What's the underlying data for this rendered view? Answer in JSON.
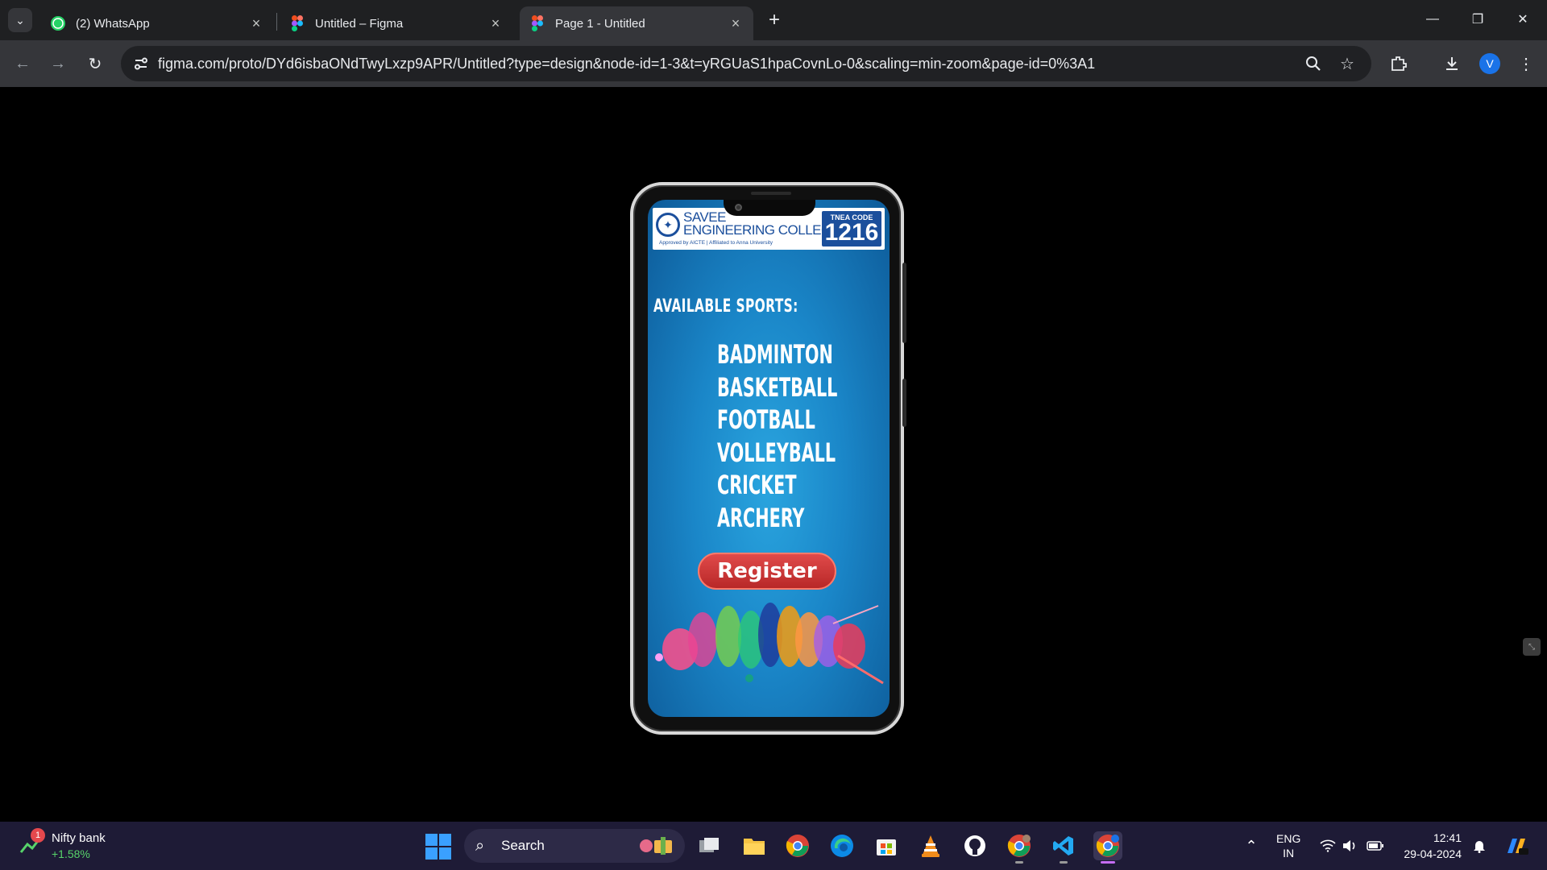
{
  "browser": {
    "tabs": [
      {
        "title": "(2) WhatsApp",
        "icon": "whatsapp-icon"
      },
      {
        "title": "Untitled – Figma",
        "icon": "figma-icon"
      },
      {
        "title": "Page 1 - Untitled",
        "icon": "figma-icon",
        "active": true
      }
    ],
    "url": "figma.com/proto/DYd6isbaONdTwyLxzp9APR/Untitled?type=design&node-id=1-3&t=yRGUaS1hpaCovnLo-0&scaling=min-zoom&page-id=0%3A1",
    "profile_initial": "V"
  },
  "phone": {
    "banner": {
      "college_line1": "SAVEE",
      "college_line2": "ENGINEERING COLLEGE",
      "college_sub": "Approved by AICTE | Affiliated to Anna University",
      "tnea_label": "TNEA CODE",
      "tnea_code": "1216"
    },
    "heading": "AVAILABLE SPORTS:",
    "sports": [
      "BADMINTON",
      "BASKETBALL",
      "FOOTBALL",
      "VOLLEYBALL",
      "CRICKET",
      "ARCHERY"
    ],
    "register_label": "Register"
  },
  "taskbar": {
    "widget_title": "Nifty bank",
    "widget_value": "+1.58%",
    "widget_badge": "1",
    "search_label": "Search",
    "lang_line1": "ENG",
    "lang_line2": "IN",
    "time": "12:41",
    "date": "29-04-2024"
  },
  "colors": {
    "accent_register": "#d43a3a",
    "screen_blue": "#1a86c8",
    "taskbar": "#1e1b36"
  }
}
